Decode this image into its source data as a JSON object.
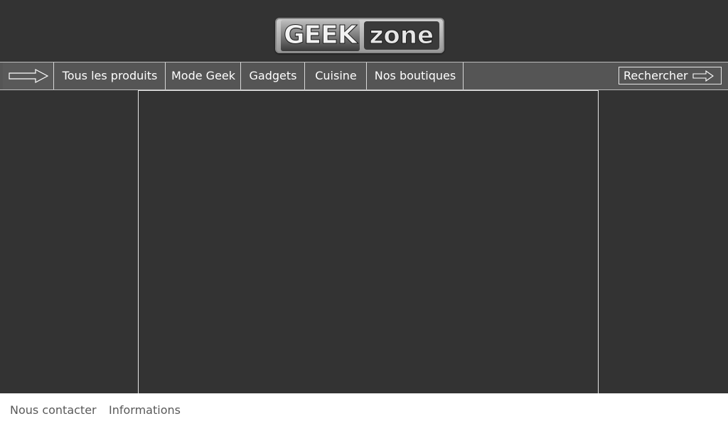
{
  "logo": {
    "word1": "GEEK",
    "word2": "zone"
  },
  "nav": {
    "home_arrow_icon": "right-arrow-icon",
    "items": [
      {
        "label": "Tous les produits"
      },
      {
        "label": "Mode Geek"
      },
      {
        "label": "Gadgets"
      },
      {
        "label": "Cuisine"
      },
      {
        "label": "Nos boutiques"
      }
    ],
    "search": {
      "label": "Rechercher",
      "icon": "right-arrow-icon"
    }
  },
  "footer": {
    "links": [
      {
        "label": "Nous contacter"
      },
      {
        "label": "Informations"
      }
    ]
  },
  "colors": {
    "background": "#333333",
    "navbar": "#555555",
    "footer": "#ffffff",
    "footer_text": "#595959",
    "lines": "#e6e6e6"
  }
}
